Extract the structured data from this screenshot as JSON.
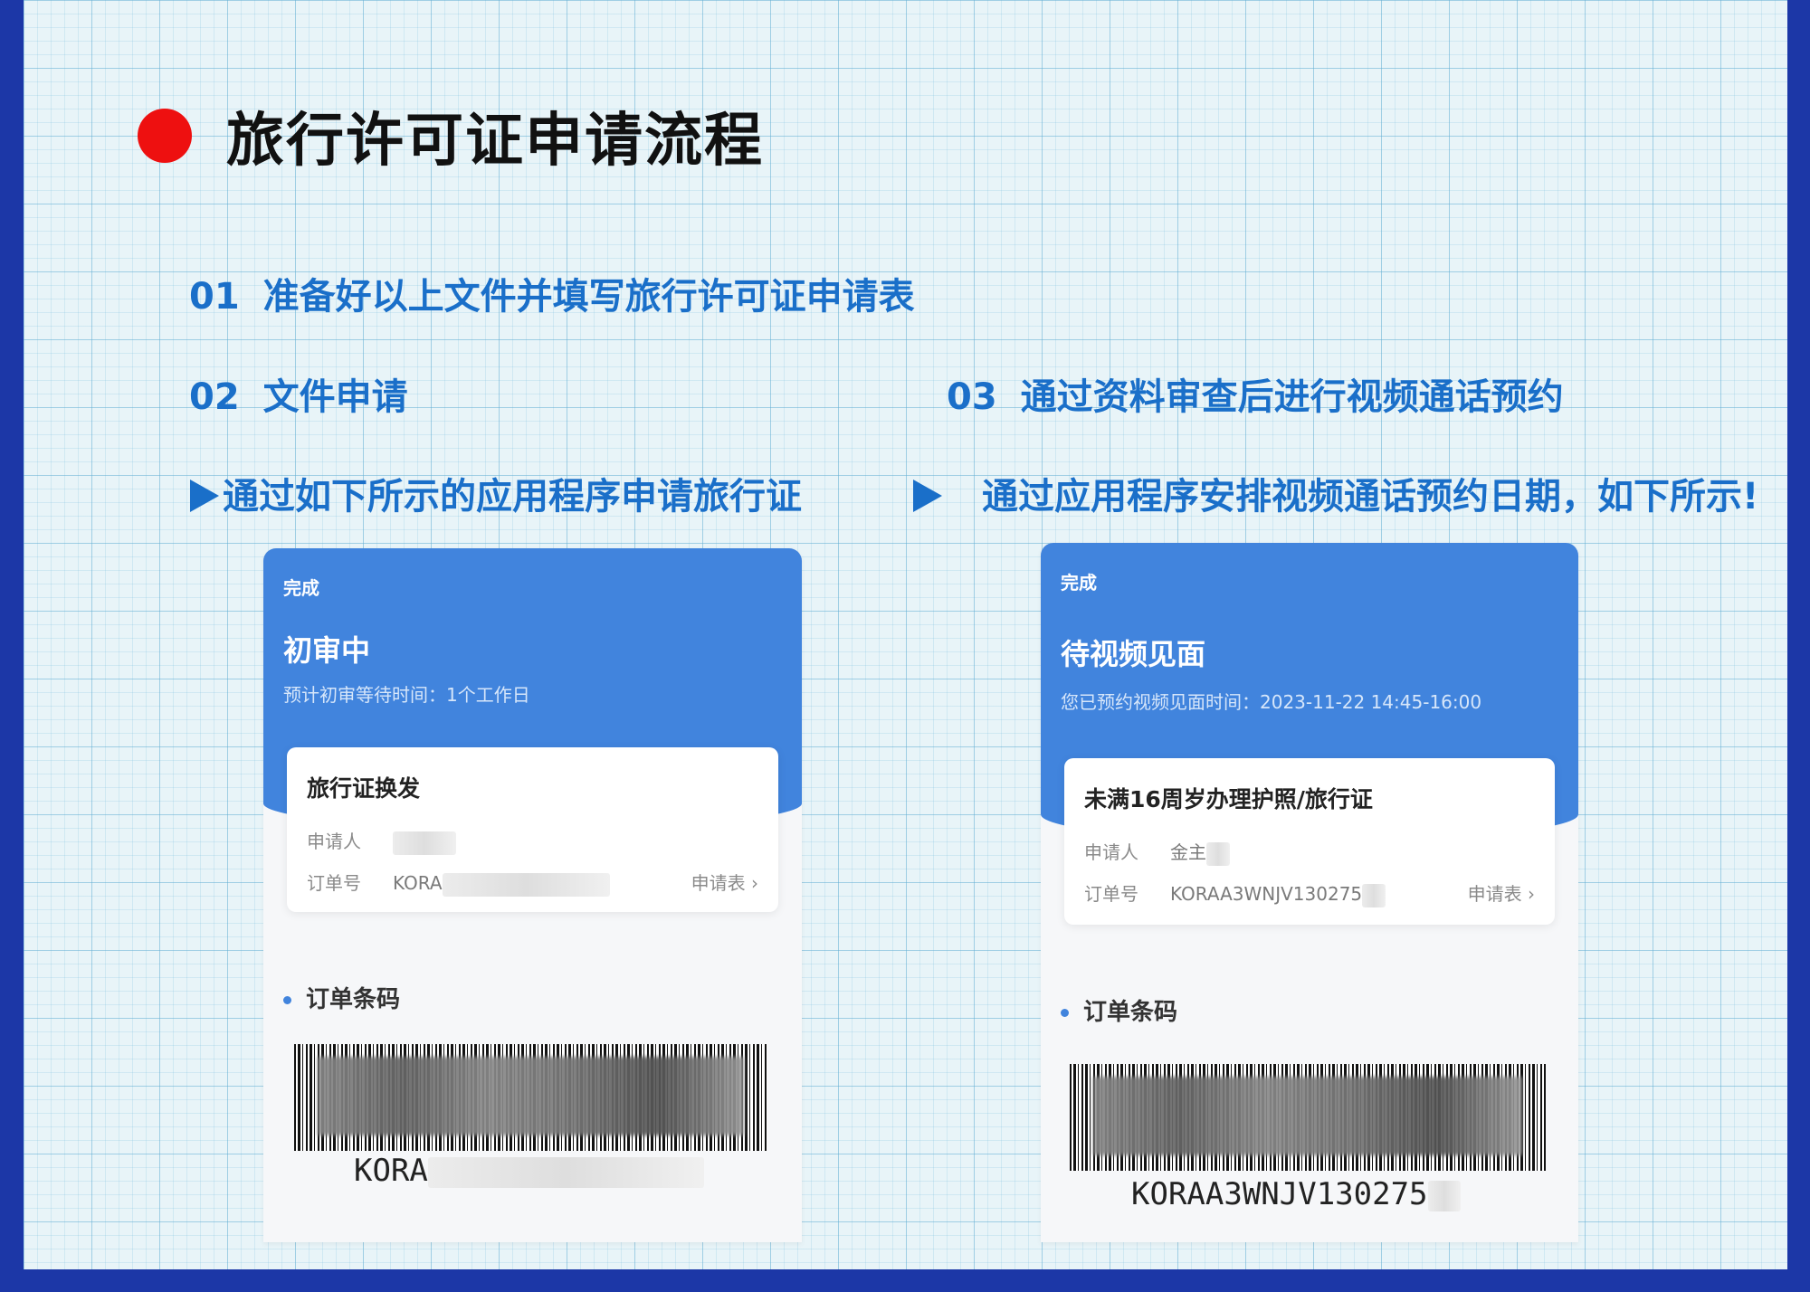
{
  "title": "旅行许可证申请流程",
  "steps": [
    {
      "num": "01",
      "text": "准备好以上文件并填写旅行许可证申请表"
    },
    {
      "num": "02",
      "text": "文件申请"
    },
    {
      "num": "03",
      "text": "通过资料审查后进行视频通话预约"
    }
  ],
  "notes": [
    "通过如下所示的应用程序申请旅行证",
    "通过应用程序安排视频通话预约日期，如下所示!"
  ],
  "colors": {
    "accent": "#1a6fc9",
    "frame": "#1c37a7",
    "dot": "#ee1010",
    "app_blue": "#4184dd"
  },
  "phone1": {
    "done": "完成",
    "status": "初审中",
    "wait": "预计初审等待时间：1个工作日",
    "card_title": "旅行证换发",
    "applicant_label": "申请人",
    "applicant_value": "",
    "order_label": "订单号",
    "order_value": "KORA",
    "form_link": "申请表 ›",
    "section": "订单条码",
    "barcode_text": "KORA"
  },
  "phone2": {
    "done": "完成",
    "status": "待视频见面",
    "wait": "您已预约视频见面时间：2023-11-22 14:45-16:00",
    "card_title": "未满16周岁办理护照/旅行证",
    "applicant_label": "申请人",
    "applicant_value": "金主",
    "order_label": "订单号",
    "order_value": "KORAA3WNJV130275",
    "form_link": "申请表 ›",
    "section": "订单条码",
    "barcode_text": "KORAA3WNJV130275"
  }
}
